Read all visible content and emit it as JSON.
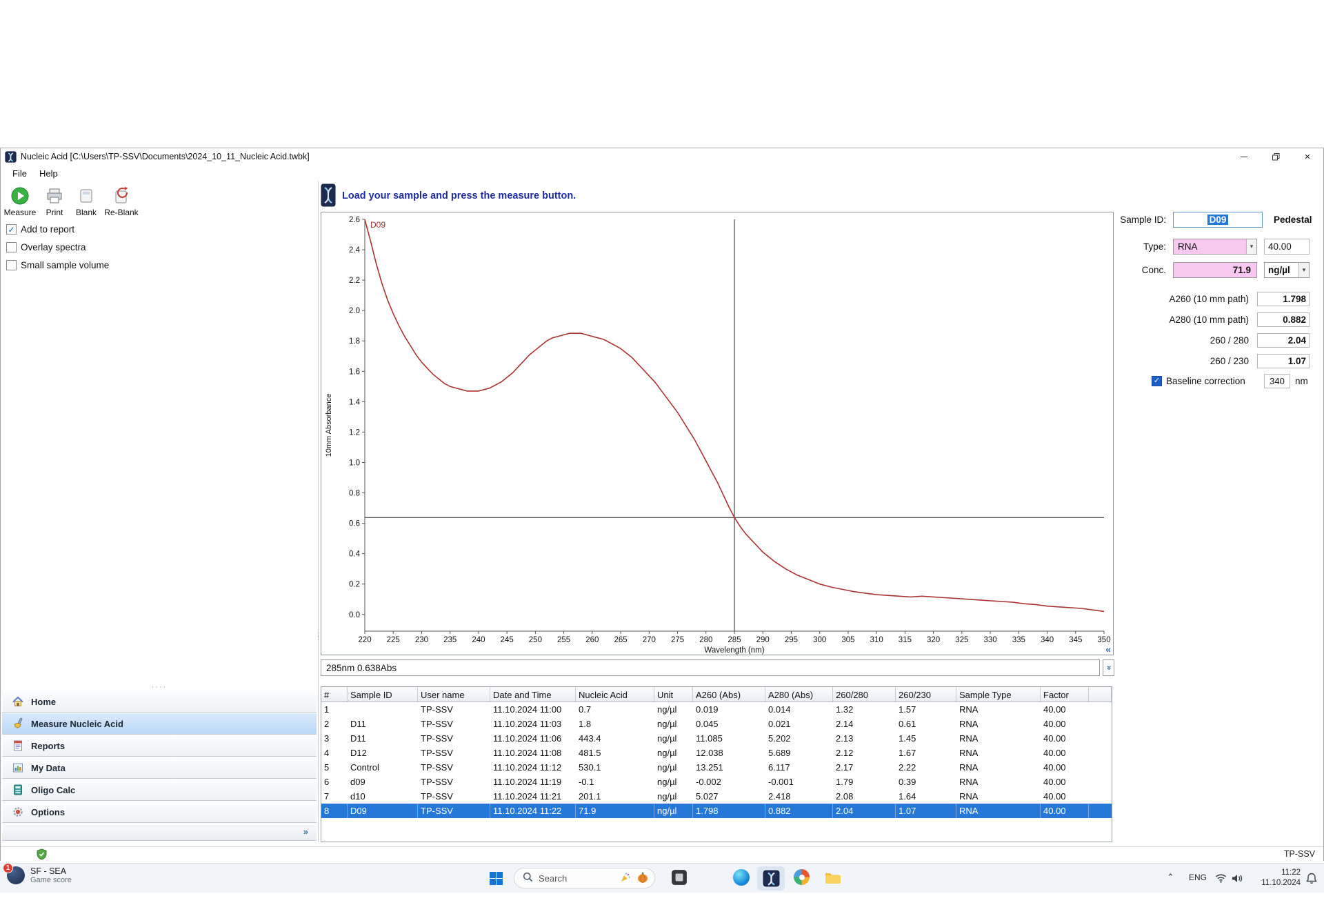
{
  "colors": {
    "highlight_pink": "#F7C9F1",
    "selection_blue": "#2577D8",
    "curve_red": "#AA3333"
  },
  "window": {
    "title": "Nucleic Acid  [C:\\Users\\TP-SSV\\Documents\\2024_10_11_Nucleic Acid.twbk]",
    "menu": [
      "File",
      "Help"
    ]
  },
  "toolbar": {
    "buttons": [
      {
        "label": "Measure",
        "icon": "measure-icon"
      },
      {
        "label": "Print",
        "icon": "print-icon"
      },
      {
        "label": "Blank",
        "icon": "blank-icon"
      },
      {
        "label": "Re-Blank",
        "icon": "reblank-icon"
      }
    ]
  },
  "options": {
    "checkboxes": [
      {
        "label": "Add to report",
        "checked": true
      },
      {
        "label": "Overlay spectra",
        "checked": false
      },
      {
        "label": "Small sample volume",
        "checked": false
      }
    ]
  },
  "message": "Load your sample and press the measure button.",
  "status_readout": "285nm 0.638Abs",
  "chart_data": {
    "type": "line",
    "series_label": "D09",
    "xlabel": "Wavelength (nm)",
    "ylabel": "10mm Absorbance",
    "xlim": [
      220,
      350
    ],
    "ylim": [
      0.0,
      2.6
    ],
    "x_ticks": [
      220,
      225,
      230,
      235,
      240,
      245,
      250,
      255,
      260,
      265,
      270,
      275,
      280,
      285,
      290,
      295,
      300,
      305,
      310,
      315,
      320,
      325,
      330,
      335,
      340,
      345,
      350
    ],
    "y_ticks": [
      0.0,
      0.2,
      0.4,
      0.6,
      0.8,
      1.0,
      1.2,
      1.4,
      1.6,
      1.8,
      2.0,
      2.2,
      2.4,
      2.6
    ],
    "cursor": {
      "x": 285,
      "y": 0.638
    },
    "x": [
      220,
      221,
      222,
      223,
      224,
      225,
      226,
      227,
      228,
      229,
      230,
      231,
      232,
      233,
      234,
      235,
      236,
      237,
      238,
      239,
      240,
      241,
      242,
      243,
      244,
      245,
      246,
      247,
      248,
      249,
      250,
      251,
      252,
      253,
      254,
      255,
      256,
      257,
      258,
      259,
      260,
      261,
      262,
      263,
      264,
      265,
      266,
      267,
      268,
      269,
      270,
      271,
      272,
      273,
      274,
      275,
      276,
      277,
      278,
      279,
      280,
      281,
      282,
      283,
      284,
      285,
      286,
      287,
      288,
      289,
      290,
      292,
      294,
      296,
      298,
      300,
      302,
      304,
      306,
      308,
      310,
      312,
      314,
      316,
      318,
      320,
      322,
      324,
      326,
      328,
      330,
      332,
      334,
      336,
      338,
      340,
      342,
      344,
      346,
      348,
      350
    ],
    "y": [
      2.6,
      2.46,
      2.31,
      2.18,
      2.07,
      1.98,
      1.9,
      1.83,
      1.77,
      1.71,
      1.66,
      1.62,
      1.58,
      1.55,
      1.52,
      1.5,
      1.49,
      1.48,
      1.47,
      1.47,
      1.47,
      1.48,
      1.49,
      1.51,
      1.53,
      1.56,
      1.59,
      1.63,
      1.67,
      1.71,
      1.74,
      1.77,
      1.8,
      1.82,
      1.83,
      1.84,
      1.85,
      1.85,
      1.85,
      1.84,
      1.83,
      1.82,
      1.81,
      1.79,
      1.77,
      1.75,
      1.72,
      1.69,
      1.65,
      1.61,
      1.57,
      1.53,
      1.48,
      1.43,
      1.38,
      1.33,
      1.27,
      1.21,
      1.15,
      1.08,
      1.01,
      0.94,
      0.87,
      0.79,
      0.71,
      0.638,
      0.58,
      0.53,
      0.49,
      0.45,
      0.41,
      0.35,
      0.3,
      0.26,
      0.23,
      0.2,
      0.18,
      0.165,
      0.15,
      0.14,
      0.13,
      0.125,
      0.12,
      0.115,
      0.12,
      0.115,
      0.11,
      0.105,
      0.1,
      0.095,
      0.09,
      0.085,
      0.08,
      0.07,
      0.065,
      0.055,
      0.05,
      0.045,
      0.04,
      0.03,
      0.02
    ]
  },
  "sample_panel": {
    "sample_id_label": "Sample ID:",
    "sample_id": "D09",
    "mode": "Pedestal",
    "type_label": "Type:",
    "type": "RNA",
    "factor": "40.00",
    "conc_label": "Conc.",
    "conc": "71.9",
    "conc_unit": "ng/µl",
    "fields": [
      {
        "label": "A260 (10 mm path)",
        "value": "1.798"
      },
      {
        "label": "A280 (10 mm path)",
        "value": "0.882"
      },
      {
        "label": "260 / 280",
        "value": "2.04"
      },
      {
        "label": "260 / 230",
        "value": "1.07"
      }
    ],
    "baseline": {
      "label": "Baseline correction",
      "checked": true,
      "value": "340",
      "unit": "nm"
    }
  },
  "table": {
    "columns": [
      "#",
      "Sample ID",
      "User name",
      "Date and Time",
      "Nucleic Acid",
      "Unit",
      "A260 (Abs)",
      "A280 (Abs)",
      "260/280",
      "260/230",
      "Sample Type",
      "Factor"
    ],
    "rows": [
      [
        "1",
        "",
        "TP-SSV",
        "11.10.2024 11:00",
        "0.7",
        "ng/µl",
        "0.019",
        "0.014",
        "1.32",
        "1.57",
        "RNA",
        "40.00"
      ],
      [
        "2",
        "D11",
        "TP-SSV",
        "11.10.2024 11:03",
        "1.8",
        "ng/µl",
        "0.045",
        "0.021",
        "2.14",
        "0.61",
        "RNA",
        "40.00"
      ],
      [
        "3",
        "D11",
        "TP-SSV",
        "11.10.2024 11:06",
        "443.4",
        "ng/µl",
        "11.085",
        "5.202",
        "2.13",
        "1.45",
        "RNA",
        "40.00"
      ],
      [
        "4",
        "D12",
        "TP-SSV",
        "11.10.2024 11:08",
        "481.5",
        "ng/µl",
        "12.038",
        "5.689",
        "2.12",
        "1.67",
        "RNA",
        "40.00"
      ],
      [
        "5",
        "Control",
        "TP-SSV",
        "11.10.2024 11:12",
        "530.1",
        "ng/µl",
        "13.251",
        "6.117",
        "2.17",
        "2.22",
        "RNA",
        "40.00"
      ],
      [
        "6",
        "d09",
        "TP-SSV",
        "11.10.2024 11:19",
        "-0.1",
        "ng/µl",
        "-0.002",
        "-0.001",
        "1.79",
        "0.39",
        "RNA",
        "40.00"
      ],
      [
        "7",
        "d10",
        "TP-SSV",
        "11.10.2024 11:21",
        "201.1",
        "ng/µl",
        "5.027",
        "2.418",
        "2.08",
        "1.64",
        "RNA",
        "40.00"
      ],
      [
        "8",
        "D09",
        "TP-SSV",
        "11.10.2024 11:22",
        "71.9",
        "ng/µl",
        "1.798",
        "0.882",
        "2.04",
        "1.07",
        "RNA",
        "40.00"
      ]
    ],
    "selected_row": 8
  },
  "nav": {
    "items": [
      {
        "label": "Home",
        "icon": "home-icon",
        "selected": false
      },
      {
        "label": "Measure Nucleic Acid",
        "icon": "measure-nucleic-acid-icon",
        "selected": true
      },
      {
        "label": "Reports",
        "icon": "reports-icon",
        "selected": false
      },
      {
        "label": "My Data",
        "icon": "my-data-icon",
        "selected": false
      },
      {
        "label": "Oligo Calc",
        "icon": "oligo-calc-icon",
        "selected": false
      },
      {
        "label": "Options",
        "icon": "options-icon",
        "selected": false
      }
    ]
  },
  "statusbar": {
    "user": "TP-SSV"
  },
  "taskbar": {
    "widget": {
      "badge": "1",
      "line1": "SF - SEA",
      "line2": "Game score"
    },
    "search": {
      "placeholder": "Search"
    },
    "tray": {
      "language": "ENG",
      "time": "11:22",
      "date": "11.10.2024"
    }
  }
}
